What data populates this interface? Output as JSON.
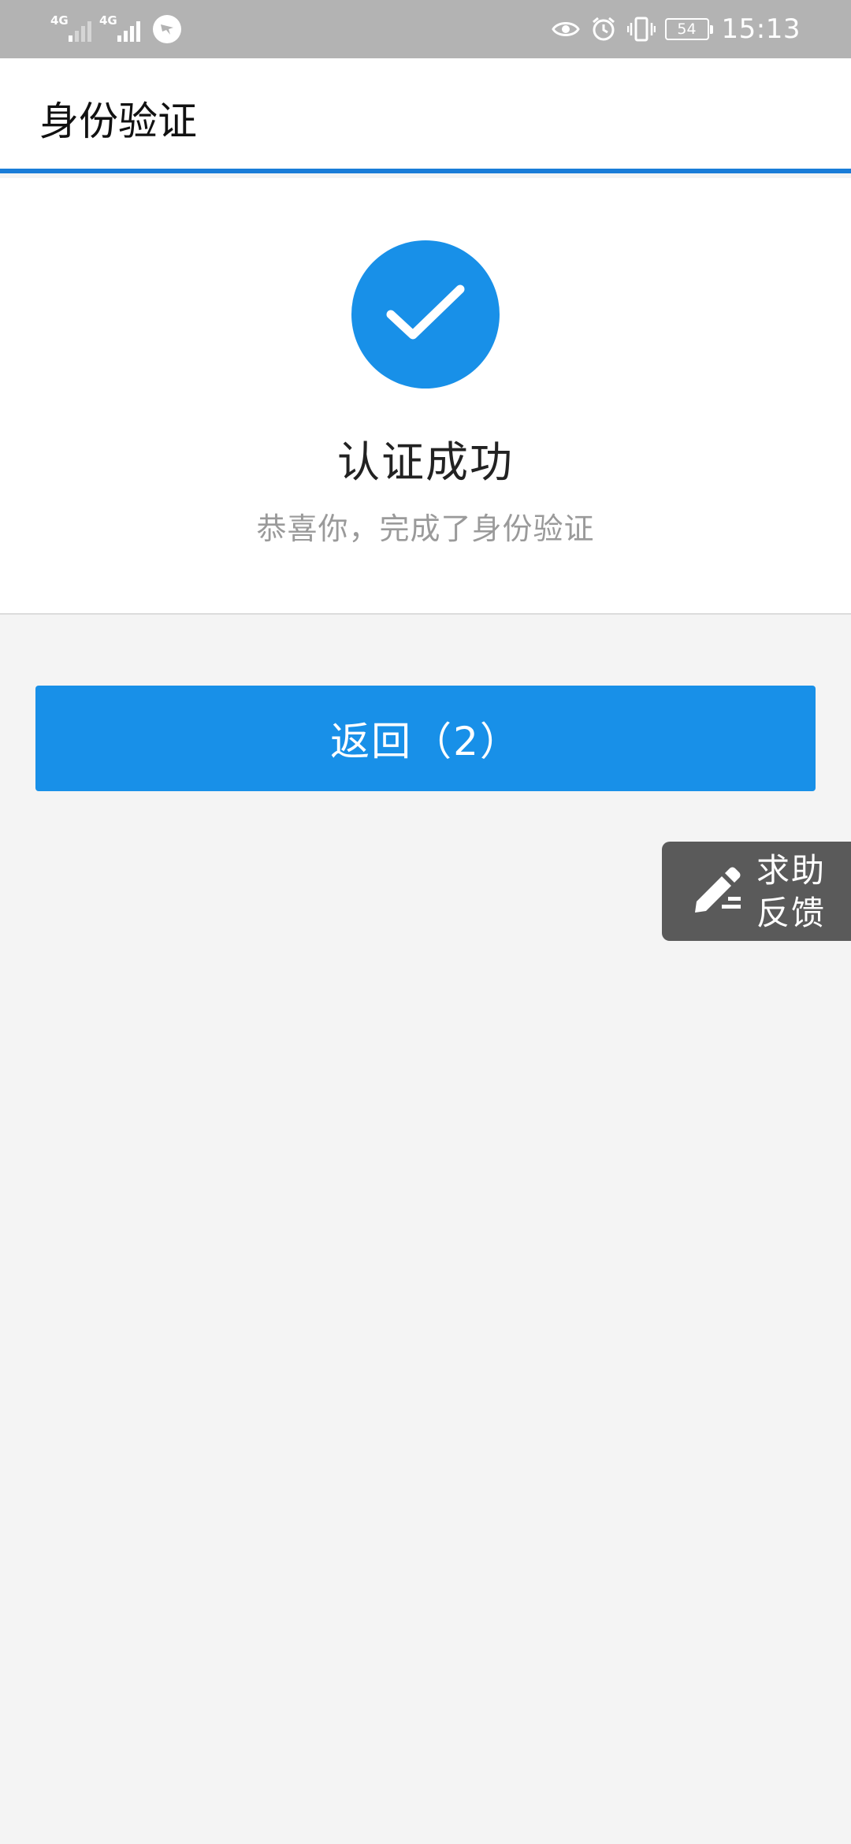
{
  "status_bar": {
    "sim1_network": "4G",
    "sim2_network": "4G",
    "battery_level": "54",
    "time": "15:13",
    "icons": [
      "signal-icon",
      "signal-icon",
      "app-notification-icon",
      "eye-icon",
      "alarm-icon",
      "vibrate-icon",
      "battery-icon"
    ]
  },
  "header": {
    "title": "身份验证",
    "accent_color": "#1a7dd8"
  },
  "result": {
    "icon": "check-circle-icon",
    "icon_color": "#1890e8",
    "title": "认证成功",
    "subtitle": "恭喜你，完成了身份验证"
  },
  "actions": {
    "back_label": "返回（2）",
    "back_color": "#1890e8"
  },
  "feedback": {
    "icon": "pencil-icon",
    "label_line1": "求助",
    "label_line2": "反馈"
  }
}
